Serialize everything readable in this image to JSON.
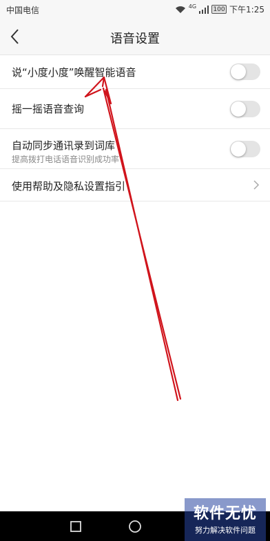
{
  "status_bar": {
    "carrier": "中国电信",
    "network": "4G",
    "battery": "100",
    "time": "下午1:25"
  },
  "header": {
    "title": "语音设置",
    "back_icon": "chevron-left-icon"
  },
  "settings": [
    {
      "label": "说“小度小度”唤醒智能语音",
      "toggle_on": false
    },
    {
      "label": "摇一摇语音查询",
      "toggle_on": false
    },
    {
      "label": "自动同步通讯录到词库",
      "sublabel": "提高拨打电话语音识别成功率",
      "toggle_on": false
    },
    {
      "label": "使用帮助及隐私设置指引",
      "icon": "chevron-right-icon"
    }
  ],
  "watermark": {
    "title": "软件无忧",
    "subtitle": "努力解决软件问题"
  },
  "colors": {
    "annotation_arrow": "#d0141c",
    "toggle_off": "#e4e4e4",
    "header_bg": "#f7f7f7"
  }
}
